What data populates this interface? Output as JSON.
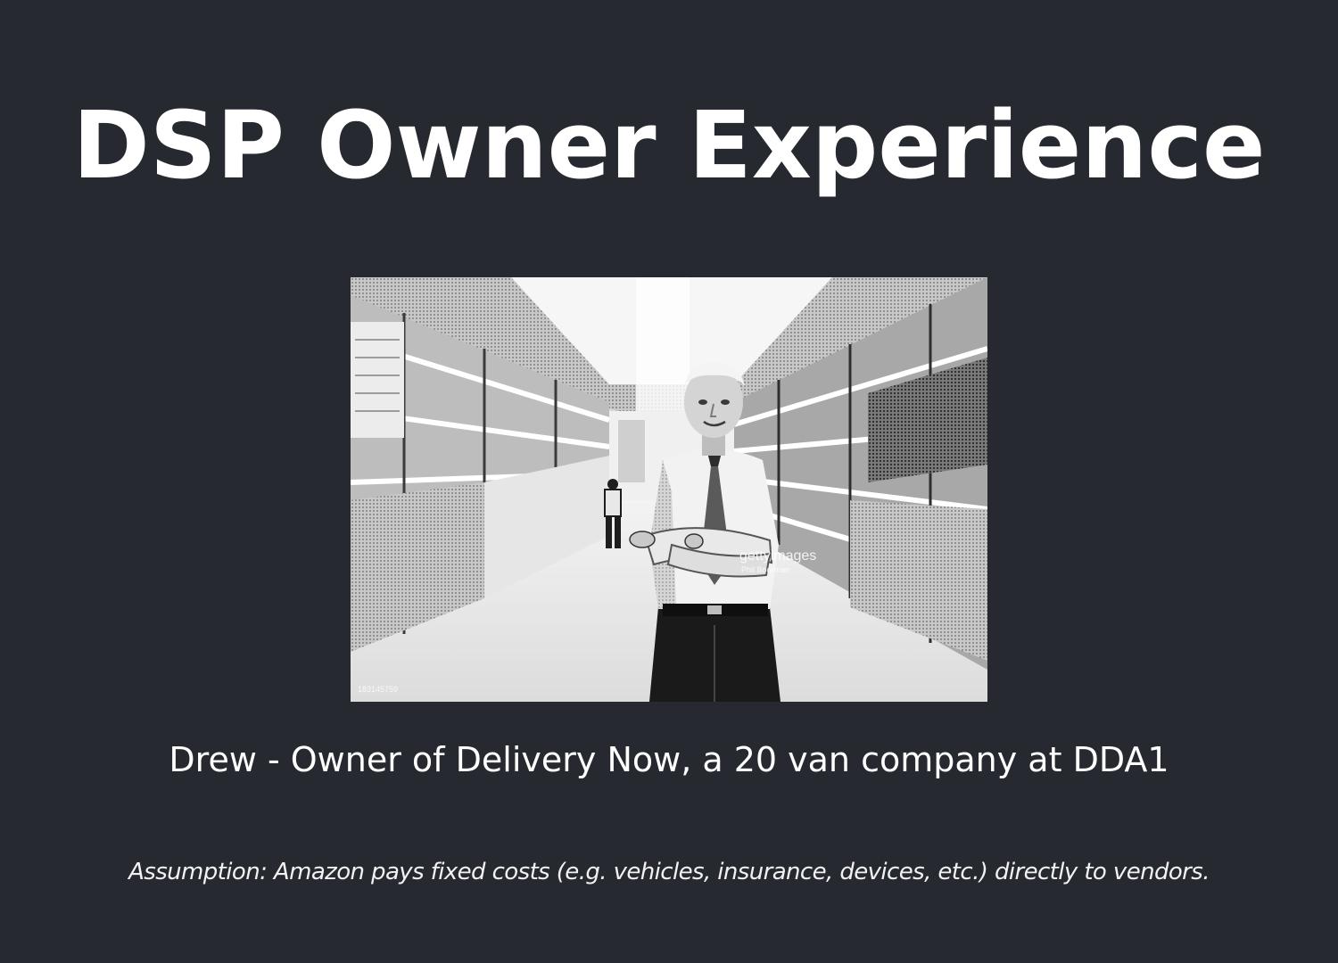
{
  "slide": {
    "title": "DSP Owner Experience",
    "subtitle": "Drew - Owner of Delivery Now, a 20 van company at DDA1",
    "footnote": "Assumption: Amazon pays fixed costs (e.g. vehicles, insurance, devices, etc.) directly to vendors.",
    "background_color": "#262930",
    "text_color": "#ffffff"
  },
  "photo": {
    "watermark_brand": "gettyimages",
    "watermark_credit": "Phil Boorman",
    "watermark_id": "183145759"
  }
}
